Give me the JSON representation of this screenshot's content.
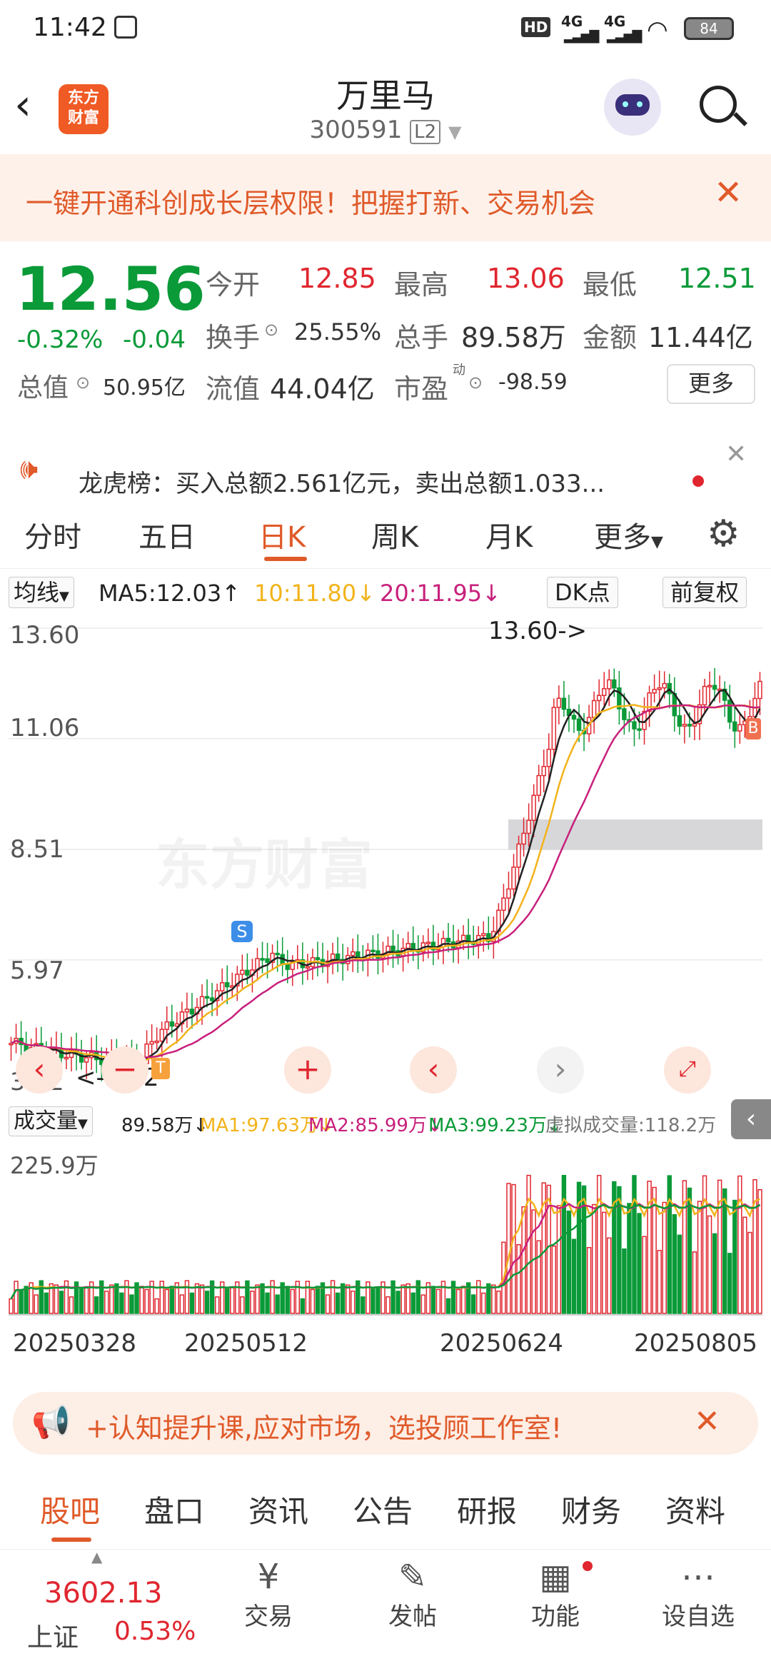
{
  "status": {
    "time": "11:42",
    "battery": "84",
    "net1": "4G",
    "net2": "4G"
  },
  "header": {
    "logo_line1": "东方",
    "logo_line2": "财富",
    "stock_name": "万里马",
    "stock_code": "300591",
    "level": "L2"
  },
  "banner": {
    "text": "一键开通科创成长层权限！把握打新、交易机会"
  },
  "quote": {
    "price": "12.56",
    "change_pct": "-0.32%",
    "change": "-0.04",
    "open_label": "今开",
    "open": "12.85",
    "high_label": "最高",
    "high": "13.06",
    "low_label": "最低",
    "low": "12.51",
    "turnover_label": "换手",
    "turnover": "25.55%",
    "volume_label": "总手",
    "volume": "89.58万",
    "amount_label": "金额",
    "amount": "11.44亿",
    "mktcap_label": "总值",
    "mktcap": "50.95亿",
    "float_label": "流值",
    "float": "44.04亿",
    "pe_label": "市盈",
    "pe_sup": "动",
    "pe": "-98.59",
    "more_button": "更多"
  },
  "lhb": {
    "text": "龙虎榜：买入总额2.561亿元，卖出总额1.033..."
  },
  "tabs": [
    "分时",
    "五日",
    "日K",
    "周K",
    "月K",
    "更多"
  ],
  "active_tab": "日K",
  "indicator": {
    "ma_select": "均线",
    "ma5": "MA5:12.03↑",
    "ma10": "10:11.80↓",
    "ma20": "20:11.95↓",
    "dk": "DK点",
    "adjust": "前复权"
  },
  "chart_data": {
    "type": "candlestick",
    "y_ticks": [
      "13.60",
      "11.06",
      "8.51",
      "5.97",
      "3.42"
    ],
    "ylim": [
      3.42,
      13.6
    ],
    "max_marker": "13.60->",
    "min_marker": "<-3.42",
    "watermark": "东方财富",
    "signal_s": "S",
    "signal_b": "B",
    "signal_t": "T",
    "ma_colors": {
      "ma5": "#222222",
      "ma10": "#f2b31b",
      "ma20": "#c8207c"
    }
  },
  "volume_bar": {
    "select": "成交量",
    "vol": "89.58万↓",
    "ma1": "MA1:97.63万↓",
    "ma2": "MA2:85.99万↓",
    "ma3": "MA3:99.23万↓",
    "virtual": "虚拟成交量:118.2万",
    "max_label": "225.9万"
  },
  "dates": [
    "20250328",
    "20250512",
    "20250624",
    "20250805"
  ],
  "promo": {
    "text": "+认知提升课,应对市场，选投顾工作室!"
  },
  "subtabs": [
    "股吧",
    "盘口",
    "资讯",
    "公告",
    "研报",
    "财务",
    "资料"
  ],
  "bottom": {
    "index_value": "3602.13",
    "index_name": "上证",
    "index_change": "0.53%",
    "items": [
      "交易",
      "发帖",
      "功能",
      "设自选"
    ]
  }
}
